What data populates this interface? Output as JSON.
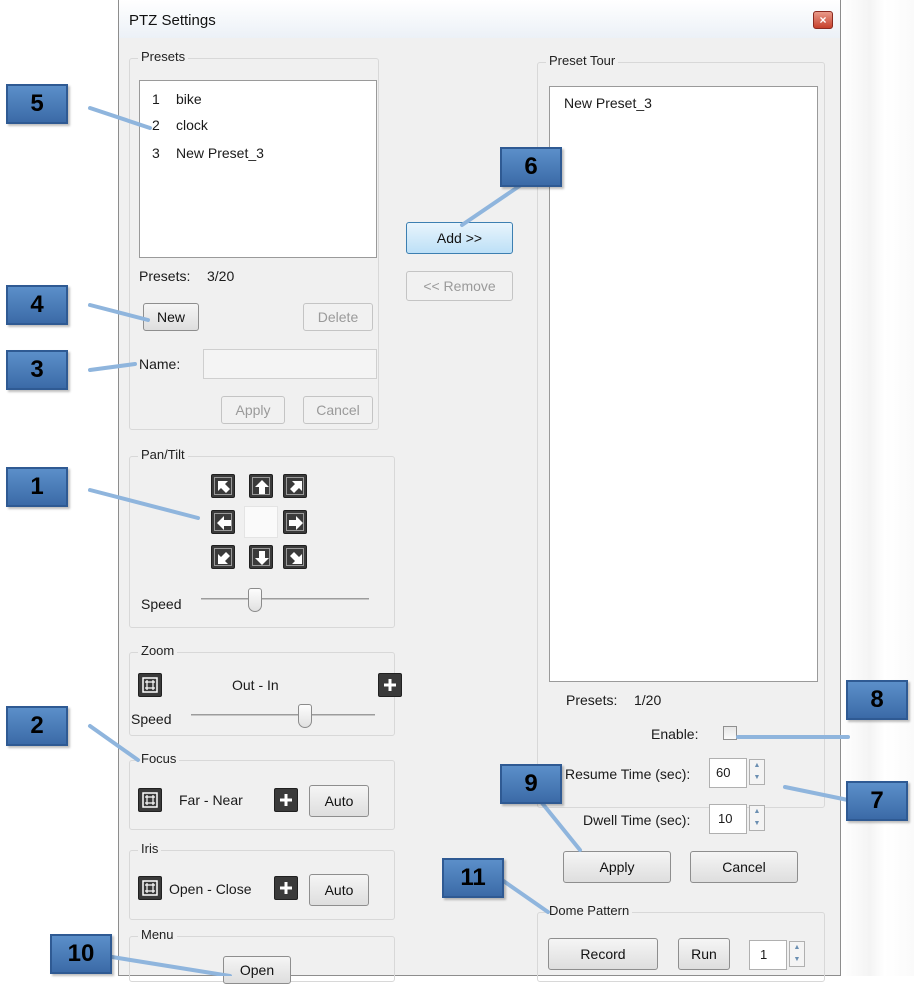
{
  "window": {
    "title": "PTZ Settings",
    "close_glyph": "×"
  },
  "presets": {
    "group_label": "Presets",
    "items": [
      {
        "num": "1",
        "name": "bike"
      },
      {
        "num": "2",
        "name": "clock"
      },
      {
        "num": "3",
        "name": "New Preset_3"
      }
    ],
    "count_label": "Presets:",
    "count_value": "3/20",
    "new_label": "New",
    "delete_label": "Delete",
    "name_label": "Name:",
    "name_value": "",
    "apply_label": "Apply",
    "cancel_label": "Cancel"
  },
  "transfer": {
    "add_label": "Add >>",
    "remove_label": "<< Remove"
  },
  "preset_tour": {
    "group_label": "Preset Tour",
    "items": [
      "New Preset_3"
    ],
    "count_label": "Presets:",
    "count_value": "1/20",
    "enable_label": "Enable:",
    "enable_checked": false,
    "resume_label": "Resume Time (sec):",
    "resume_value": "60",
    "dwell_label": "Dwell Time (sec):",
    "dwell_value": "10",
    "apply_label": "Apply",
    "cancel_label": "Cancel"
  },
  "pan_tilt": {
    "group_label": "Pan/Tilt",
    "speed_label": "Speed",
    "speed_level": 0.32
  },
  "zoom": {
    "group_label": "Zoom",
    "range_label": "Out - In",
    "speed_label": "Speed",
    "speed_level": 0.62
  },
  "focus": {
    "group_label": "Focus",
    "range_label": "Far - Near",
    "auto_label": "Auto"
  },
  "iris": {
    "group_label": "Iris",
    "range_label": "Open - Close",
    "auto_label": "Auto"
  },
  "menu": {
    "group_label": "Menu",
    "open_label": "Open"
  },
  "dome_pattern": {
    "group_label": "Dome Pattern",
    "record_label": "Record",
    "run_label": "Run",
    "pattern_value": "1"
  },
  "callouts": [
    "1",
    "2",
    "3",
    "4",
    "5",
    "6",
    "7",
    "8",
    "9",
    "10",
    "11"
  ],
  "colors": {
    "callout_fill": "#4a7dbb",
    "callout_border": "#2f5a93",
    "accent": "#3c7fb1",
    "leader": "#6f9fd1"
  }
}
